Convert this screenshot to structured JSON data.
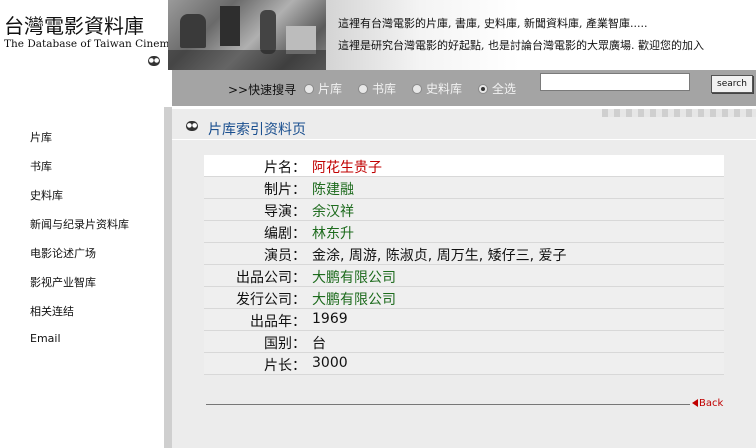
{
  "logo": {
    "title": "台灣電影資料庫",
    "subtitle": "The Database of Taiwan Cinema"
  },
  "banner": {
    "line1": "這裡有台灣電影的片庫, 書庫, 史料庫, 新聞資料庫, 產業智庫.....",
    "line2": "這裡是研究台灣電影的好起點, 也是討論台灣電影的大眾廣場. 歡迎您的加入"
  },
  "search": {
    "label": ">>快速搜寻",
    "options": [
      "片库",
      "书库",
      "史料库",
      "全选"
    ],
    "selected": "全选",
    "value": "",
    "button_label": "search"
  },
  "sidebar": {
    "items": [
      "片库",
      "书库",
      "史料库",
      "新闻与纪录片资料库",
      "电影论述广场",
      "影视产业智库",
      "相关连结",
      "Email"
    ]
  },
  "page": {
    "section_title": "片库索引资料页",
    "back_label": "Back"
  },
  "film": {
    "fields": [
      {
        "label": "片名：",
        "value": "阿花生贵子"
      },
      {
        "label": "制片：",
        "value": "陈建融"
      },
      {
        "label": "导演：",
        "value": "余汉祥"
      },
      {
        "label": "编剧：",
        "value": "林东升"
      },
      {
        "label": "演员：",
        "value": "金涂, 周游, 陈淑贞, 周万生, 矮仔三, 爱子"
      },
      {
        "label": "出品公司：",
        "value": "大鹏有限公司"
      },
      {
        "label": "发行公司：",
        "value": "大鹏有限公司"
      },
      {
        "label": "出品年：",
        "value": "1969"
      },
      {
        "label": "国别：",
        "value": "台"
      },
      {
        "label": "片长：",
        "value": "3000"
      }
    ]
  },
  "colors": {
    "link_red": "#c00000",
    "link_green": "#1d6b1d",
    "title_blue": "#1a4f8f"
  }
}
